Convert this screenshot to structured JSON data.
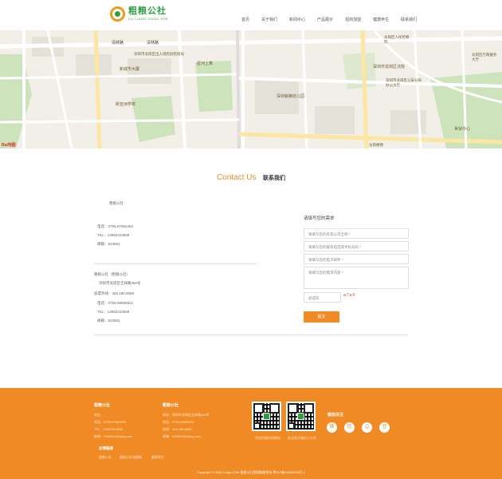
{
  "header": {
    "logo_title": "粗粮公社",
    "logo_sub": "CU LIANG GONG SHE",
    "nav": [
      "首页",
      "关于我们",
      "新闻中心",
      "产品展示",
      "招商加盟",
      "健康养生",
      "联系我们"
    ]
  },
  "map": {
    "labels": [
      "清林路",
      "清林路",
      "深圳市龙岗区出入境检验检疫局",
      "新城市大厦",
      "星河上寓",
      "新亚洲学校",
      "深圳市龙岗区法院",
      "龙岗区人民检察院",
      "深圳市龙岗区公安分局办公大厅",
      "深圳紫薇幼儿园",
      "龙岗区行政服务大厅",
      "世贸中心",
      "龙岗楼巷"
    ],
    "brand": "Bai地图"
  },
  "contact": {
    "title_en": "Contact Us",
    "title_zh": "联系我们"
  },
  "office1": {
    "name": "粗粮公社",
    "phone": "电话：0755-87862453",
    "tel": "TEL：13652310559",
    "email": "邮箱：523681"
  },
  "office2": {
    "name": "粗粮公社（粗粮公社）",
    "address": "深圳市龙岗区吉祥路360号",
    "hotline": "加盟热线：400.185.8599",
    "phone": "电话：0755-89985821",
    "tel": "TEL：13652310559",
    "email": "邮箱：523681"
  },
  "form": {
    "title": "请填写您的需求",
    "company_placeholder": "请填写您的名或公司全称 *",
    "phone_placeholder": "请填写您的联系电话或手机号码 *",
    "email_placeholder": "请填写您的电子邮件 *",
    "message_placeholder": "请填写您的需求内容 *",
    "captcha_placeholder": "验证码",
    "captcha_text": "a7a6",
    "submit": "提交"
  },
  "footer": {
    "col1_head": "粗粮公社",
    "col1_lines": [
      "地址：",
      "电话：0755-87862453",
      "TEL：13652310559",
      "邮箱：2380518(8@qq.com"
    ],
    "col2_head": "粗粮公社",
    "col2_lines": [
      "地址：深圳市龙岗区吉祥路360号",
      "电话：0755-89985821",
      "热线：400.185.8599",
      "邮箱：2380518(8@qq.com"
    ],
    "links_head": "友情链接",
    "links": [
      "粗粮公社",
      "粗粮公社加盟网",
      "健康养生"
    ],
    "qr1_caption": "手机扫描访问网站",
    "qr2_caption": "关注官方微信公众号",
    "follow_head": "微信关注",
    "social_icons": [
      "weibo-icon",
      "wechat-icon",
      "qq-icon",
      "douban-icon"
    ],
    "copyright": "Copyright © 2016 Culgs.COM 粗粮公社官网版权所有  粤ICP备16035695号-1"
  }
}
